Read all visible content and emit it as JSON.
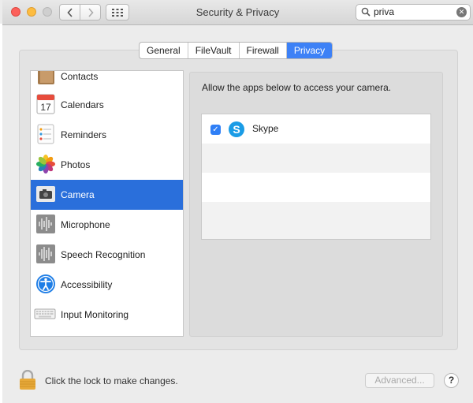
{
  "window": {
    "title": "Security & Privacy"
  },
  "search": {
    "value": "priva",
    "clear_icon": "clear-icon"
  },
  "tabs": [
    {
      "label": "General",
      "active": false
    },
    {
      "label": "FileVault",
      "active": false
    },
    {
      "label": "Firewall",
      "active": false
    },
    {
      "label": "Privacy",
      "active": true
    }
  ],
  "sidebar": {
    "items": [
      {
        "label": "Contacts",
        "icon": "contacts-icon"
      },
      {
        "label": "Calendars",
        "icon": "calendar-icon",
        "icon_text": "17"
      },
      {
        "label": "Reminders",
        "icon": "reminders-icon"
      },
      {
        "label": "Photos",
        "icon": "photos-icon"
      },
      {
        "label": "Camera",
        "icon": "camera-icon",
        "selected": true
      },
      {
        "label": "Microphone",
        "icon": "microphone-icon"
      },
      {
        "label": "Speech Recognition",
        "icon": "speech-recognition-icon"
      },
      {
        "label": "Accessibility",
        "icon": "accessibility-icon"
      },
      {
        "label": "Input Monitoring",
        "icon": "keyboard-icon"
      }
    ]
  },
  "main": {
    "description": "Allow the apps below to access your camera.",
    "apps": [
      {
        "name": "Skype",
        "checked": true,
        "icon": "skype-icon",
        "icon_letter": "S"
      }
    ]
  },
  "footer": {
    "lock_text": "Click the lock to make changes.",
    "advanced_label": "Advanced...",
    "help_label": "?"
  },
  "colors": {
    "accent": "#2a6fdb",
    "tab_active": "#3d81f6",
    "close": "#fc605b",
    "minimize": "#fdbc40"
  }
}
